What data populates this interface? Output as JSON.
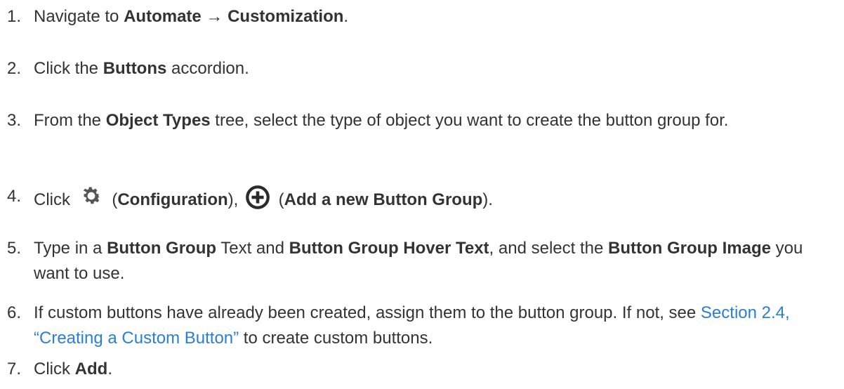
{
  "steps": [
    {
      "num": "1.",
      "text_1": "Navigate to ",
      "bold_1": "Automate",
      "arrow": " → ",
      "bold_2": "Customization",
      "text_2": "."
    },
    {
      "num": "2.",
      "text_1": "Click the ",
      "bold_1": "Buttons",
      "text_2": " accordion."
    },
    {
      "num": "3.",
      "text_1": "From the ",
      "bold_1": "Object Types",
      "text_2": " tree, select the type of object you want to create the button group for."
    },
    {
      "num": "4.",
      "text_1": "Click ",
      "paren_open_1": " (",
      "bold_1": "Configuration",
      "paren_close_1": "), ",
      "paren_open_2": " (",
      "bold_2": "Add a new Button Group",
      "paren_close_2": ").",
      "icons": [
        "gear-icon",
        "plus-circle-icon"
      ]
    },
    {
      "num": "5.",
      "text_1": "Type in a ",
      "bold_1": "Button Group",
      "text_2": " Text and ",
      "bold_2": "Button Group Hover Text",
      "text_3": ", and select the ",
      "bold_3": "Button Group Image",
      "text_4": " you want to use."
    },
    {
      "num": "6.",
      "text_1": "If custom buttons have already been created, assign them to the button group. If not, see ",
      "link": "Section 2.4, “Creating a Custom Button”",
      "text_2": " to create custom buttons."
    },
    {
      "num": "7.",
      "text_1": "Click ",
      "bold_1": "Add",
      "text_2": "."
    }
  ],
  "colors": {
    "text": "#333333",
    "link": "#2a7fd4",
    "icon": "#333333"
  }
}
